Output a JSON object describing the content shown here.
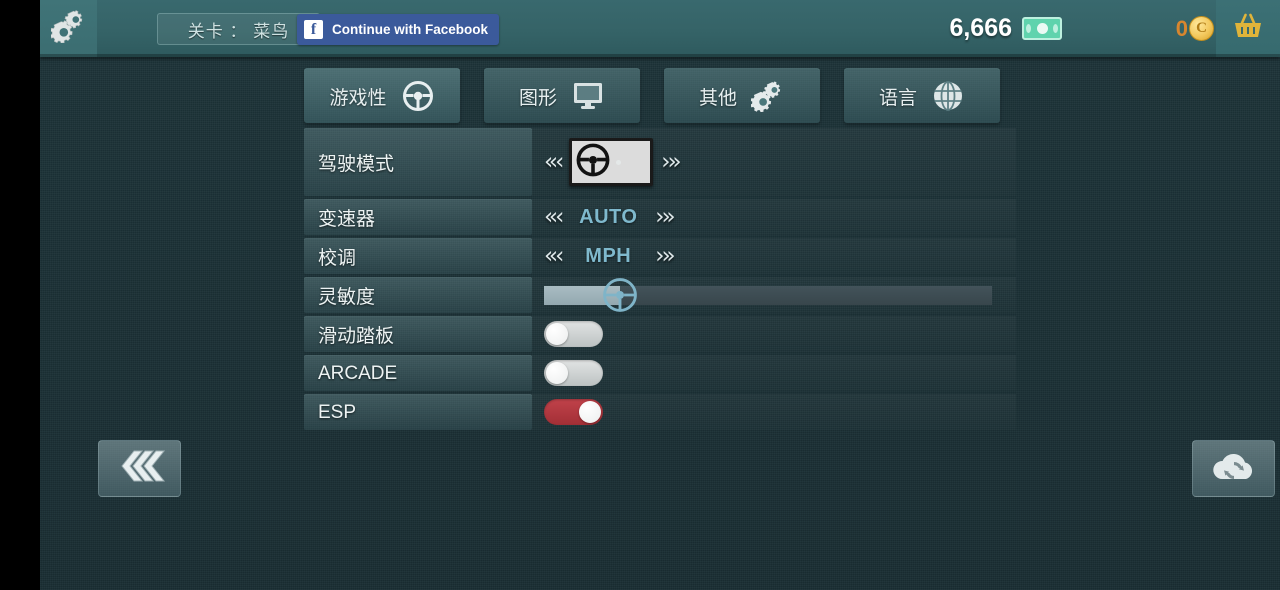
{
  "topbar": {
    "settings_icon": "gears-icon",
    "level_text": "关卡 ： 菜鸟",
    "facebook_label": "Continue with Facebook",
    "facebook_glyph": "f",
    "money_value": "6,666",
    "money_icon": "banknote-icon",
    "coin_value": "0",
    "coin_glyph": "C",
    "coin_icon": "coin-icon",
    "shop_icon": "basket-icon",
    "colors": {
      "bar": "#356367",
      "facebook": "#3b5a9b",
      "coin": "#d8862e",
      "money_bill": "#5fd3ad"
    }
  },
  "tabs": [
    {
      "label": "游戏性",
      "icon": "steering-wheel-icon",
      "active": true
    },
    {
      "label": "图形",
      "icon": "monitor-icon",
      "active": false
    },
    {
      "label": "其他",
      "icon": "gears-icon",
      "active": false
    },
    {
      "label": "语言",
      "icon": "globe-icon",
      "active": false
    }
  ],
  "settings": {
    "rows": [
      {
        "label": "驾驶模式",
        "type": "selector-image",
        "value_icon": "steering-wheel-icon",
        "left_arrow": "«‹",
        "right_arrow": "›»"
      },
      {
        "label": "变速器",
        "type": "selector-text",
        "value": "AUTO",
        "left_arrow": "«‹",
        "right_arrow": "›»"
      },
      {
        "label": "校调",
        "type": "selector-text",
        "value": "MPH",
        "left_arrow": "«‹",
        "right_arrow": "›»"
      },
      {
        "label": "灵敏度",
        "type": "slider",
        "value": 17,
        "thumb_icon": "steering-wheel-icon"
      },
      {
        "label": "滑动踏板",
        "type": "toggle",
        "value": "off"
      },
      {
        "label": "ARCADE",
        "type": "toggle",
        "value": "off"
      },
      {
        "label": "ESP",
        "type": "toggle",
        "value": "on"
      }
    ],
    "value_color": "#7fb9cd",
    "toggle_on_color": "#b03a3f"
  },
  "footer": {
    "back_icon": "triple-chevron-left-icon",
    "back_glyph": "««",
    "cloud_icon": "cloud-sync-icon"
  }
}
